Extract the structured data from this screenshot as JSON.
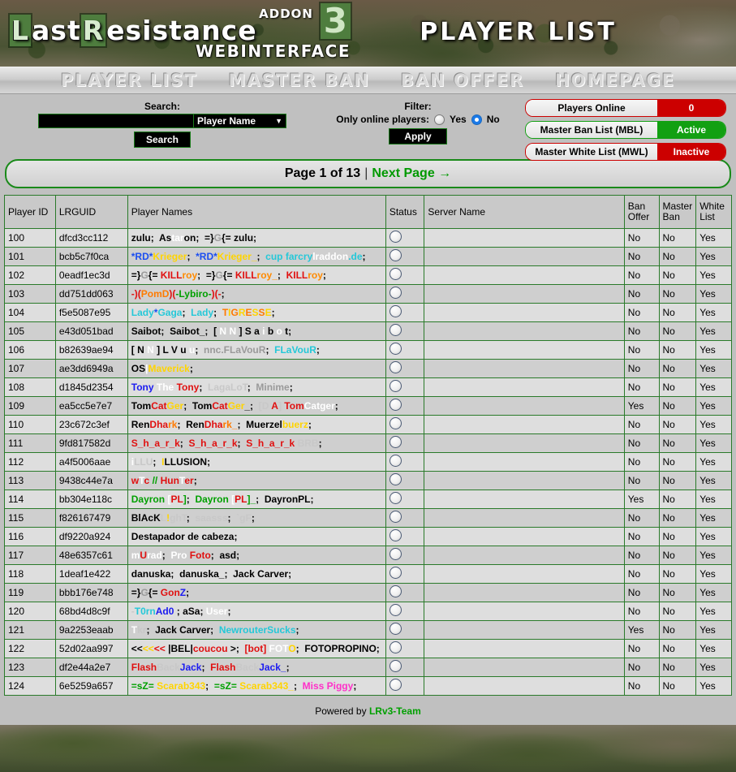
{
  "header": {
    "logo_last": "ast",
    "logo_l": "L",
    "logo_r": "R",
    "logo_esistance": "esistance",
    "logo_addon": "ADDON",
    "logo_three": "3",
    "logo_web": "WEBINTERFACE",
    "page_title": "PLAYER LIST"
  },
  "nav": [
    {
      "label": "PLAYER LIST"
    },
    {
      "label": "MASTER BAN"
    },
    {
      "label": "BAN OFFER"
    },
    {
      "label": "HOMEPAGE"
    }
  ],
  "search": {
    "label": "Search:",
    "value": "",
    "placeholder": "",
    "selected_option": "Player Name",
    "options": [
      "Player Name"
    ],
    "button_label": "Search"
  },
  "filter": {
    "label": "Filter:",
    "only_online_label": "Only online players:",
    "yes_label": "Yes",
    "no_label": "No",
    "selected": "No",
    "apply_label": "Apply"
  },
  "status_pills": [
    {
      "label": "Players Online",
      "value": "0",
      "state": "red"
    },
    {
      "label": "Master Ban List (MBL)",
      "value": "Active",
      "state": "green"
    },
    {
      "label": "Master White List (MWL)",
      "value": "Inactive",
      "state": "red"
    }
  ],
  "pagination": {
    "page_text": "Page 1 of 13",
    "separator": "|",
    "next_label": "Next Page →",
    "current_page": 1,
    "total_pages": 13
  },
  "table": {
    "columns": [
      "Player ID",
      "LRGUID",
      "Player Names",
      "Status",
      "Server Name",
      "Ban Offer",
      "Master Ban",
      "White List"
    ],
    "column_banoffer_line1": "Ban",
    "column_banoffer_line2": "Offer",
    "column_masterban_line1": "Master",
    "column_masterban_line2": "Ban",
    "column_whitelist_line1": "White",
    "column_whitelist_line2": "List",
    "rows": [
      {
        "id": "100",
        "guid": "dfcd3cc112",
        "names_html": "zulu;&nbsp; As<span style=\"color:#ffffff\">tar</span>on;&nbsp; =}<span style=\"color:#9a9a9a\">G</span>{= zulu;",
        "status": "offline",
        "server": "",
        "ban_offer": "No",
        "master_ban": "No",
        "white_list": "Yes"
      },
      {
        "id": "101",
        "guid": "bcb5c7f0ca",
        "names_html": "<span style=\"color:#1b4ef0\">*RD*</span><span style=\"color:#ffd400\">Krieger</span>;&nbsp; <span style=\"color:#1b4ef0\">*RD*</span><span style=\"color:#ffd400\">Krieger_</span>;&nbsp; <span style=\"color:#25c8d8\">cup farcry</span><span style=\"color:#ffffff\">lraddon</span><span style=\"color:#25c8d8\">.de</span>;",
        "status": "offline",
        "server": "",
        "ban_offer": "No",
        "master_ban": "No",
        "white_list": "Yes"
      },
      {
        "id": "102",
        "guid": "0eadf1ec3d",
        "names_html": "=}<span style=\"color:#9a9a9a\">G</span>{= <span style=\"color:#e01010\">KILL</span><span style=\"color:#ff8a00\">roy</span>;&nbsp; =}<span style=\"color:#9a9a9a\">G</span>{= <span style=\"color:#e01010\">KILL</span><span style=\"color:#ff8a00\">roy_</span>;&nbsp; <span style=\"color:#e01010\">KILL</span><span style=\"color:#ff8a00\">roy</span>;",
        "status": "offline",
        "server": "",
        "ban_offer": "No",
        "master_ban": "No",
        "white_list": "Yes"
      },
      {
        "id": "103",
        "guid": "dd751dd063",
        "names_html": "<span style=\"color:#e01010\">-)(</span><span style=\"color:#ff7a00\">PomD</span><span style=\"color:#e01010\">)(</span><span style=\"color:#00a000\">-Lybiro-</span><span style=\"color:#e01010\">)(-</span>;",
        "status": "offline",
        "server": "",
        "ban_offer": "No",
        "master_ban": "No",
        "white_list": "Yes"
      },
      {
        "id": "104",
        "guid": "f5e5087e95",
        "names_html": "<span style=\"color:#25c8d8\">Lady</span><span style=\"color:#1b4ef0\">*</span><span style=\"color:#25c8d8\">Gaga</span>;&nbsp; <span style=\"color:#25c8d8\">Lady</span>;&nbsp; <span style=\"color:#ff7a00\">T</span><span style=\"color:#ffd400\">I</span><span style=\"color:#ff7a00\">G</span><span style=\"color:#ffd400\">R</span><span style=\"color:#ff7a00\">E</span><span style=\"color:#ffd400\">S</span><span style=\"color:#ff7a00\">S</span><span style=\"color:#ffd400\">E</span>;",
        "status": "offline",
        "server": "",
        "ban_offer": "No",
        "master_ban": "No",
        "white_list": "Yes"
      },
      {
        "id": "105",
        "guid": "e43d051bad",
        "names_html": "Saibot;&nbsp; Saibot_;&nbsp; [ <span style=\"color:#ffffff\">N</span> <span style=\"color:#ffffff\">N</span> ] <span style=\"color:#000000\">S</span> a <span style=\"color:#ffffff\">i</span> b <span style=\"color:#ffffff\">o</span> t;",
        "status": "offline",
        "server": "",
        "ban_offer": "No",
        "master_ban": "No",
        "white_list": "Yes"
      },
      {
        "id": "106",
        "guid": "b82639ae94",
        "names_html": "[ <span style=\"color:#000000\">N</span> <span style=\"color:#ffffff\">N</span> ] <span style=\"color:#000000\">L</span> <span style=\"color:#000000\">V</span> <span style=\"color:#000000\">u</span> <span style=\"color:#ffffff\">u</span>;&nbsp; <span style=\"color:#9a9a9a\">nnc.FLaVouR</span>;&nbsp; <span style=\"color:#25c8d8\">FLaVouR</span>;",
        "status": "offline",
        "server": "",
        "ban_offer": "No",
        "master_ban": "No",
        "white_list": "Yes"
      },
      {
        "id": "107",
        "guid": "ae3dd6949a",
        "names_html": "<span style=\"color:#000000\">OS</span><span style=\"color:#ffffff\">|</span><span style=\"color:#ffd400\">Maverick</span>;",
        "status": "offline",
        "server": "",
        "ban_offer": "No",
        "master_ban": "No",
        "white_list": "Yes"
      },
      {
        "id": "108",
        "guid": "d1845d2354",
        "names_html": "<span style=\"color:#1b1bf0\">Tony</span> <span style=\"color:#ffffff\">The</span> <span style=\"color:#e01010\">Tony</span>;&nbsp; <span style=\"color:#c8c8c8\">LagaLoT</span>;&nbsp; <span style=\"color:#9a9a9a\">Minime</span>;",
        "status": "offline",
        "server": "",
        "ban_offer": "No",
        "master_ban": "No",
        "white_list": "Yes"
      },
      {
        "id": "109",
        "guid": "ea5cc5e7e7",
        "names_html": "Tom<span style=\"color:#e01010\">Cat</span><span style=\"color:#ffd400\">Ger</span>;&nbsp; Tom<span style=\"color:#e01010\">Cat</span><span style=\"color:#ffd400\">Ger</span>_;&nbsp; <span style=\"color:#c8c8c8\">[D</span> <span style=\"color:#e01010\">A</span><span style=\"color:#c8c8c8\">]</span> <span style=\"color:#e01010\">Tom</span><span style=\"color:#ffffff\">Catger</span>;",
        "status": "offline",
        "server": "",
        "ban_offer": "Yes",
        "master_ban": "No",
        "white_list": "Yes"
      },
      {
        "id": "110",
        "guid": "23c672c3ef",
        "names_html": "Ren<span style=\"color:#e01010\">Dha</span><span style=\"color:#ff7a00\">rk</span>;&nbsp; Ren<span style=\"color:#e01010\">Dha</span><span style=\"color:#ff7a00\">rk_</span>;&nbsp; Muerzel<span style=\"color:#ffd400\">buerz</span>;",
        "status": "offline",
        "server": "",
        "ban_offer": "No",
        "master_ban": "No",
        "white_list": "Yes"
      },
      {
        "id": "111",
        "guid": "9fd817582d",
        "names_html": "<span style=\"color:#e01010\">S_h_a_r_k</span>;&nbsp; <span style=\"color:#e01010\">S_h_a_r_k</span>;&nbsp; <span style=\"color:#e01010\">S_h_a_r_k</span> <span style=\"color:#c8c8c8\">BRB</span>;",
        "status": "offline",
        "server": "",
        "ban_offer": "No",
        "master_ban": "No",
        "white_list": "Yes"
      },
      {
        "id": "112",
        "guid": "a4f5006aae",
        "names_html": "<span style=\"color:#ffffff\">i</span><span style=\"color:#c8c8c8\">LLU</span>;&nbsp; <span style=\"color:#ffd400\">I</span><span style=\"color:#000000\">LLUSION</span>;",
        "status": "offline",
        "server": "",
        "ban_offer": "No",
        "master_ban": "No",
        "white_list": "Yes"
      },
      {
        "id": "113",
        "guid": "9438c44e7a",
        "names_html": "<span style=\"color:#e01010\">w</span><span style=\"color:#ffffff\">T</span><span style=\"color:#e01010\">c</span> <span style=\"color:#00a000\">//</span> <span style=\"color:#e01010\">Hun</span><span style=\"color:#ffffff\">T</span><span style=\"color:#e01010\">er</span>;",
        "status": "offline",
        "server": "",
        "ban_offer": "No",
        "master_ban": "No",
        "white_list": "Yes"
      },
      {
        "id": "114",
        "guid": "bb304e118c",
        "names_html": "<span style=\"color:#00a000\">Dayron</span> <span style=\"color:#ffffff\">[</span><span style=\"color:#e01010\">PL</span><span style=\"color:#00a000\">]</span>;&nbsp; <span style=\"color:#00a000\">Dayron</span> <span style=\"color:#ffffff\">[</span><span style=\"color:#e01010\">PL</span><span style=\"color:#00a000\">]_</span>;&nbsp; DayronPL;",
        "status": "offline",
        "server": "",
        "ban_offer": "Yes",
        "master_ban": "No",
        "white_list": "Yes"
      },
      {
        "id": "115",
        "guid": "f826167479",
        "names_html": "BlAcK<span style=\"color:#c8c8c8\">L</span><span style=\"color:#ffd400\">!</span><span style=\"color:#c8c8c8\">ghT</span>;&nbsp; <span style=\"color:#c8c8c8\">saasss</span>;&nbsp; <span style=\"color:#c8c8c8\">`gF</span>;",
        "status": "offline",
        "server": "",
        "ban_offer": "No",
        "master_ban": "No",
        "white_list": "Yes"
      },
      {
        "id": "116",
        "guid": "df9220a924",
        "names_html": "Destapador de cabeza;",
        "status": "offline",
        "server": "",
        "ban_offer": "No",
        "master_ban": "No",
        "white_list": "Yes"
      },
      {
        "id": "117",
        "guid": "48e6357c61",
        "names_html": "<span style=\"color:#ffffff\">m</span><span style=\"color:#e01010\">U</span><span style=\"color:#ffffff\">rad</span>;&nbsp; <span style=\"color:#ffffff\">Pro </span><span style=\"color:#e01010\">Foto</span>;&nbsp; asd;",
        "status": "offline",
        "server": "",
        "ban_offer": "No",
        "master_ban": "No",
        "white_list": "Yes"
      },
      {
        "id": "118",
        "guid": "1deaf1e422",
        "names_html": "danuska;&nbsp; danuska_;&nbsp; Jack Carver;",
        "status": "offline",
        "server": "",
        "ban_offer": "No",
        "master_ban": "No",
        "white_list": "Yes"
      },
      {
        "id": "119",
        "guid": "bbb176e748",
        "names_html": "=}<span style=\"color:#9a9a9a\">G</span>{= <span style=\"color:#e01010\">Gon</span><span style=\"color:#1b1bf0\">Z</span>;",
        "status": "offline",
        "server": "",
        "ban_offer": "No",
        "master_ban": "No",
        "white_list": "Yes"
      },
      {
        "id": "120",
        "guid": "68bd4d8c9f",
        "names_html": "<span style=\"color:#c8c8c8\">-</span><span style=\"color:#25c8d8\">T0rn</span><span style=\"color:#1b1bf0\">Ad0</span> ; aSa; <span style=\"color:#ffffff\">User</span>;",
        "status": "offline",
        "server": "",
        "ban_offer": "No",
        "master_ban": "No",
        "white_list": "Yes"
      },
      {
        "id": "121",
        "guid": "9a2253eaab",
        "names_html": "<span style=\"color:#ffffff\">T</span><span style=\"color:#c8c8c8\">kr</span>;&nbsp; Jack Carver;&nbsp; <span style=\"color:#25c8d8\">Newrouter</span><span style=\"color:#25c8d8\">Sucks</span>;",
        "status": "offline",
        "server": "",
        "ban_offer": "Yes",
        "master_ban": "No",
        "white_list": "Yes"
      },
      {
        "id": "122",
        "guid": "52d02aa997",
        "names_html": "&lt;&lt;<span style=\"color:#ffd400\">&lt;&lt;</span><span style=\"color:#e01010\">&lt;&lt;</span> |BEL|<span style=\"color:#e01010\">coucou</span> &gt;;&nbsp; <span style=\"color:#e01010\">[bot]</span> <span style=\"color:#ffffff\">FOT</span><span style=\"color:#ffd400\">O</span>;&nbsp; FOTOPROPINO;",
        "status": "offline",
        "server": "",
        "ban_offer": "No",
        "master_ban": "No",
        "white_list": "Yes"
      },
      {
        "id": "123",
        "guid": "df2e44a2e7",
        "names_html": "<span style=\"color:#e01010\">Flash</span><span style=\"color:#c8c8c8\">Back</span><span style=\"color:#1b1bf0\">Jack</span>;&nbsp; <span style=\"color:#e01010\">Flash</span><span style=\"color:#c8c8c8\">Back</span><span style=\"color:#1b1bf0\">Jack_</span>;",
        "status": "offline",
        "server": "",
        "ban_offer": "No",
        "master_ban": "No",
        "white_list": "Yes"
      },
      {
        "id": "124",
        "guid": "6e5259a657",
        "names_html": "<span style=\"color:#00a000\">=sZ=</span> <span style=\"color:#ffd400\">Scarab343</span>;&nbsp; <span style=\"color:#00a000\">=sZ=</span> <span style=\"color:#ffd400\">Scarab343_</span>;&nbsp; <span style=\"color:#ff2fc8\">Miss Piggy</span>;",
        "status": "offline",
        "server": "",
        "ban_offer": "No",
        "master_ban": "No",
        "white_list": "Yes"
      }
    ]
  },
  "footer": {
    "powered_by": "Powered by",
    "team": "LRv3-Team"
  },
  "colors": {
    "accent_green": "#1a8a1a",
    "link_green": "#009900",
    "status_red": "#cc0000",
    "status_green": "#12a012",
    "page_bg": "#c0c0c0"
  }
}
